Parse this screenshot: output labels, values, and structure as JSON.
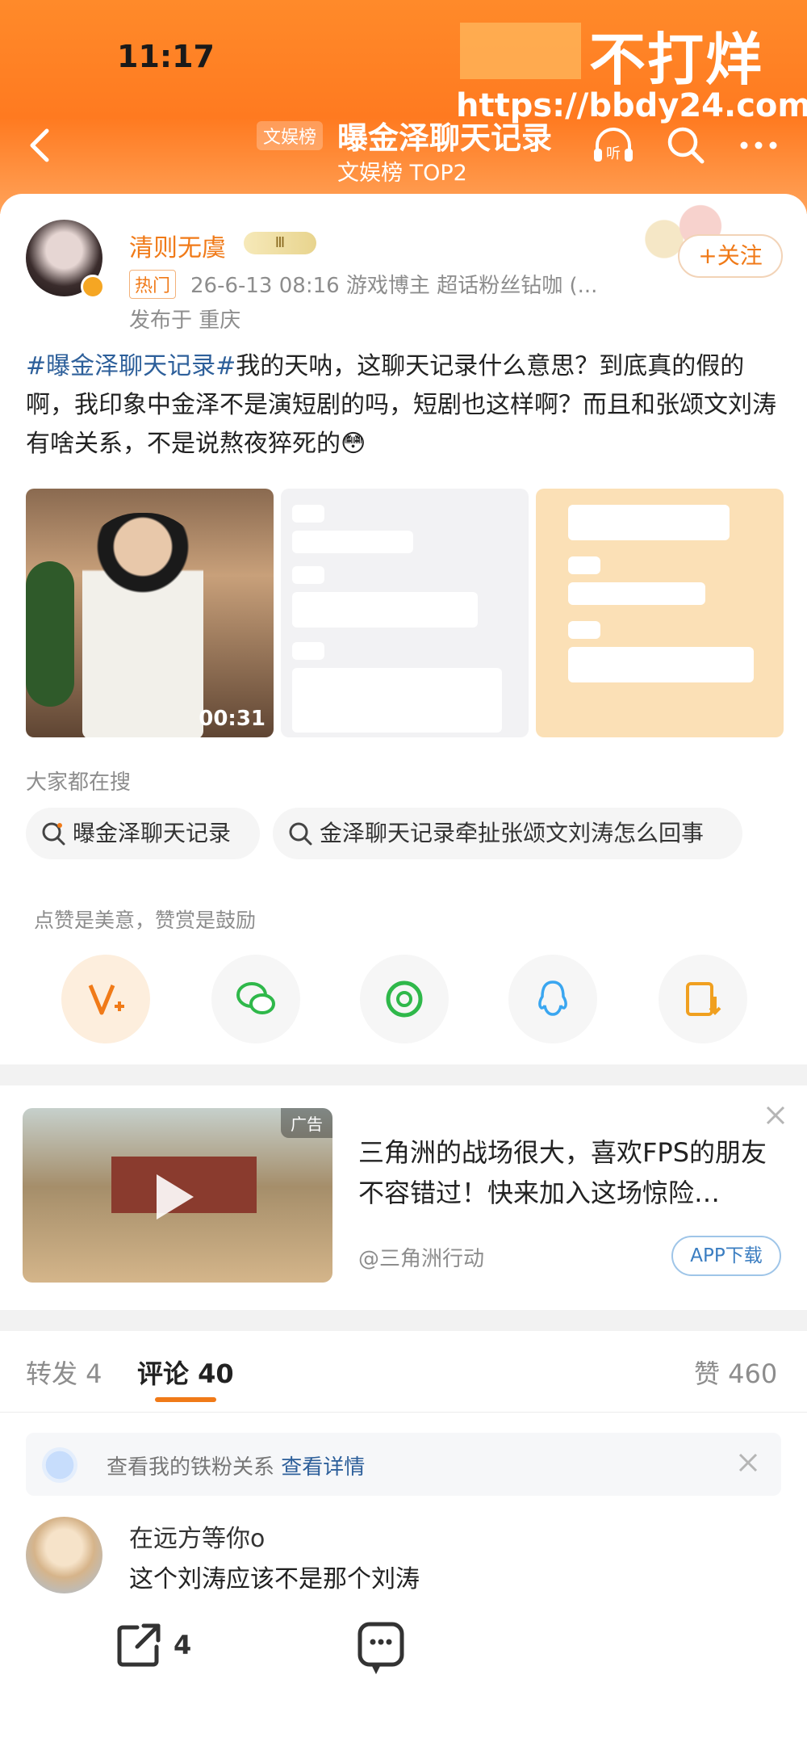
{
  "status_bar": {
    "time": "11:17"
  },
  "watermark": {
    "title": "不打烊",
    "url": "https://bbdy24.com"
  },
  "header": {
    "tag": "文娱榜",
    "title": "曝金泽聊天记录",
    "subtitle": "文娱榜 TOP2",
    "listen_label": "听"
  },
  "post": {
    "author": "清则无虞",
    "level_badge": "Ⅲ",
    "hot_label": "热门",
    "meta": "26-6-13 08:16  游戏博主 超话粉丝钻咖 (...",
    "location": "发布于 重庆",
    "follow_label": "+关注",
    "text_tag": "#曝金泽聊天记录#",
    "text_body": "我的天呐，这聊天记录什么意思？到底真的假的啊，我印象中金泽不是演短剧的吗，短剧也这样啊？而且和张颂文刘涛有啥关系，不是说熬夜猝死的😳",
    "video_duration": "00:31"
  },
  "search": {
    "label": "大家都在搜",
    "chips": [
      "曝金泽聊天记录",
      "金泽聊天记录牵扯张颂文刘涛怎么回事"
    ]
  },
  "share": {
    "hint": "点赞是美意，赞赏是鼓励",
    "icons": [
      "reward-icon",
      "wechat-icon",
      "moments-icon",
      "qq-icon",
      "save-image-icon"
    ]
  },
  "ad": {
    "tag": "广告",
    "text": "三角洲的战场很大，喜欢FPS的朋友不容错过！快来加入这场惊险…",
    "source": "@三角洲行动",
    "download_label": "APP下载"
  },
  "tabs": {
    "repost": "转发 4",
    "comment": "评论 40",
    "like": "赞 460"
  },
  "fan_bar": {
    "text": "查看我的铁粉关系",
    "link": "查看详情"
  },
  "comment": {
    "name": "在远方等你o",
    "text": "这个刘涛应该不是那个刘涛"
  },
  "bottom_bar": {
    "repost_count": "4"
  },
  "colors": {
    "brand_orange": "#ff7a20",
    "accent": "#f07a18",
    "link": "#2d5f9a"
  }
}
